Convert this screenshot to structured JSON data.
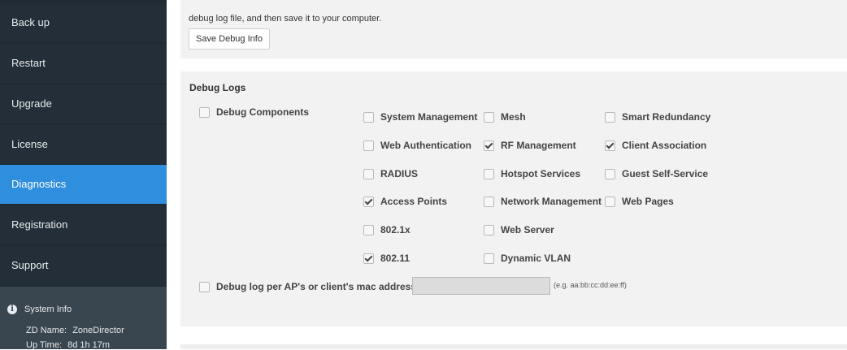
{
  "sidebar": {
    "items": [
      {
        "label": "Back up",
        "active": false
      },
      {
        "label": "Restart",
        "active": false
      },
      {
        "label": "Upgrade",
        "active": false
      },
      {
        "label": "License",
        "active": false
      },
      {
        "label": "Diagnostics",
        "active": true
      },
      {
        "label": "Registration",
        "active": false
      },
      {
        "label": "Support",
        "active": false
      }
    ],
    "system_info": {
      "title": "System Info",
      "icon": "info-icon",
      "zd_name_label": "ZD Name:",
      "zd_name_value": "ZoneDirector",
      "uptime_label": "Up Time:",
      "uptime_value": "8d 1h 17m"
    }
  },
  "debug_info": {
    "text": "debug log file, and then save it to your computer.",
    "button_label": "Save Debug Info"
  },
  "debug_logs": {
    "title": "Debug Logs",
    "debug_components": {
      "label": "Debug Components",
      "checked": false
    },
    "components": [
      {
        "label": "System Management",
        "checked": false
      },
      {
        "label": "Mesh",
        "checked": false
      },
      {
        "label": "Smart Redundancy",
        "checked": false
      },
      {
        "label": "Web Authentication",
        "checked": false
      },
      {
        "label": "RF Management",
        "checked": true
      },
      {
        "label": "Client Association",
        "checked": true
      },
      {
        "label": "RADIUS",
        "checked": false
      },
      {
        "label": "Hotspot Services",
        "checked": false
      },
      {
        "label": "Guest Self-Service",
        "checked": false
      },
      {
        "label": "Access Points",
        "checked": true
      },
      {
        "label": "Network Management",
        "checked": false
      },
      {
        "label": "Web Pages",
        "checked": false
      },
      {
        "label": "802.1x",
        "checked": false
      },
      {
        "label": "Web Server",
        "checked": false
      },
      {
        "label": "802.11",
        "checked": true
      },
      {
        "label": "Dynamic VLAN",
        "checked": false
      }
    ],
    "mac_filter": {
      "label": "Debug log per AP's or client's mac address",
      "checked": false,
      "value": "",
      "hint": "(e.g. aa:bb:cc:dd:ee:ff)"
    }
  },
  "colors": {
    "sidebar_bg": "#232e38",
    "active_item": "#2f8edd",
    "panel_bg": "#f2f2f2"
  }
}
